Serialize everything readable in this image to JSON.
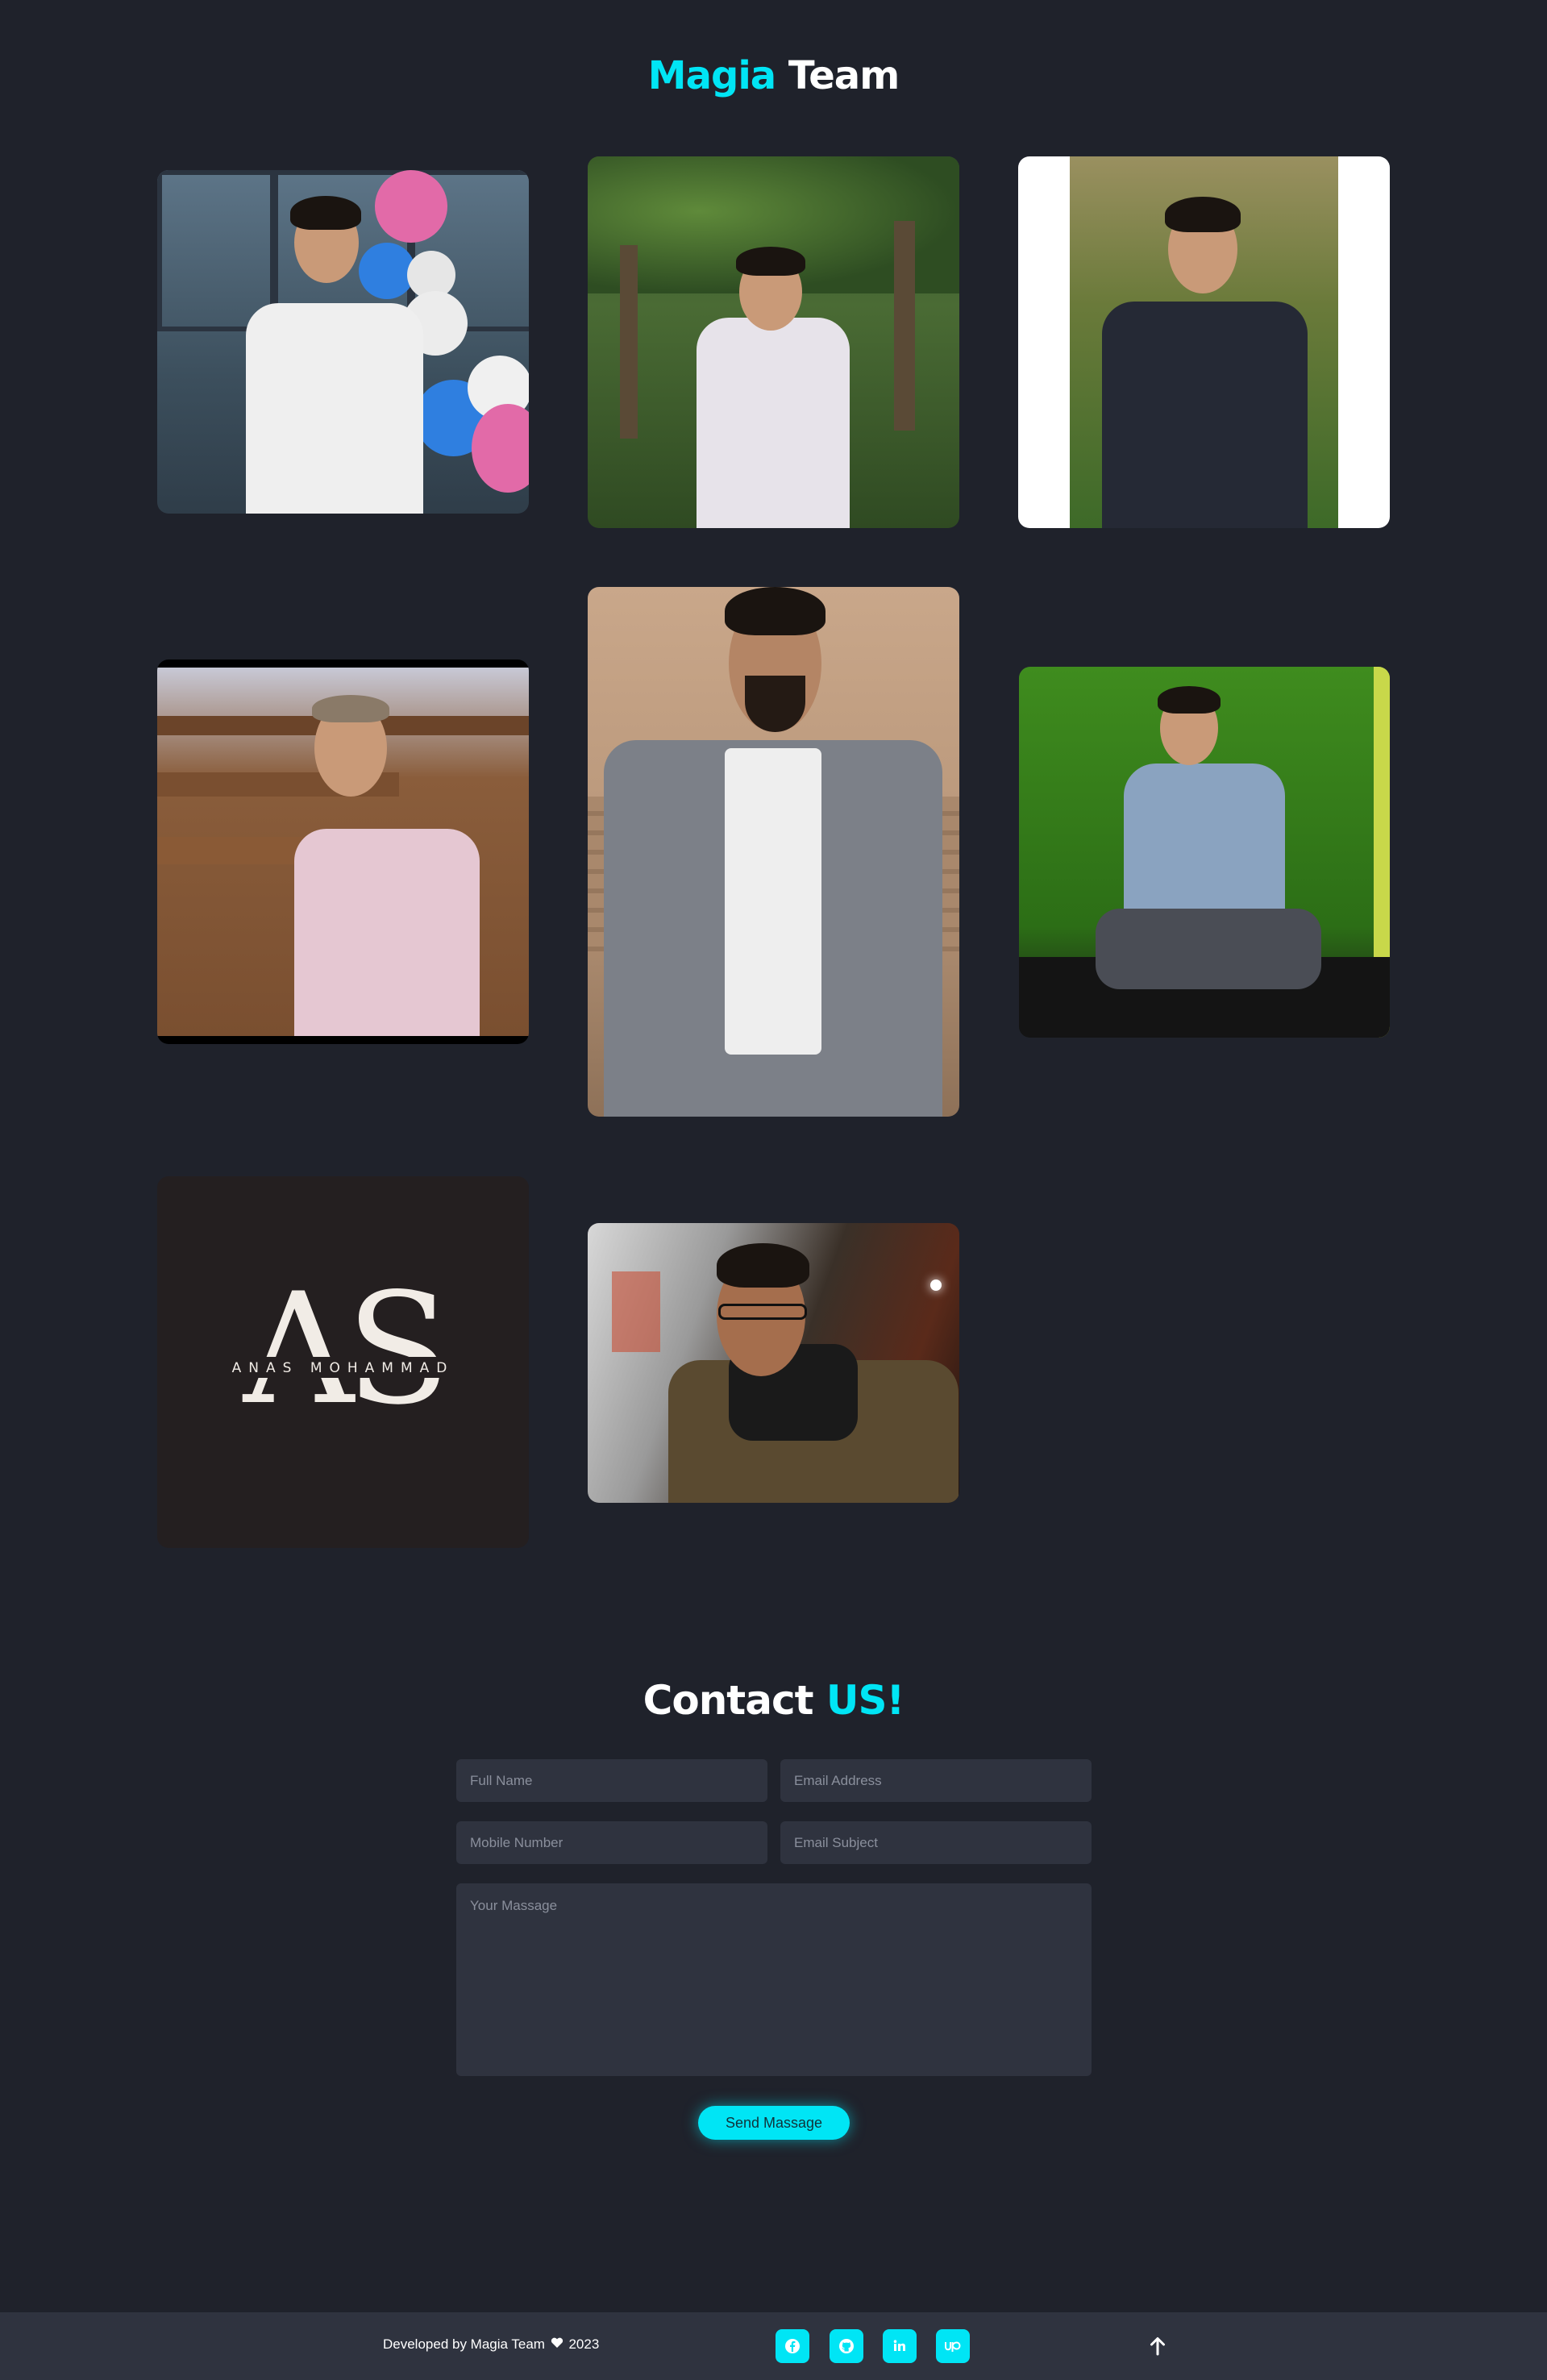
{
  "team_section": {
    "title_accent": "Magia",
    "title_rest": "Team",
    "logo_card": {
      "letters": "AS",
      "name": "ANAS MOHAMMAD"
    }
  },
  "contact": {
    "title_main": "Contact",
    "title_accent": "US!",
    "full_name_placeholder": "Full Name",
    "email_placeholder": "Email Address",
    "mobile_placeholder": "Mobile Number",
    "subject_placeholder": "Email Subject",
    "message_placeholder": "Your Massage",
    "send_label": "Send Massage"
  },
  "footer": {
    "credit_prefix": "Developed by Magia Team",
    "credit_year": "2023",
    "heart_icon": "heart-icon",
    "social_icons": [
      "facebook-icon",
      "github-icon",
      "linkedin-icon",
      "upwork-icon"
    ],
    "back_to_top_icon": "arrow-up-icon"
  },
  "colors": {
    "accent": "#00e5f5",
    "background": "#1f222b",
    "panel": "#2f333f"
  }
}
